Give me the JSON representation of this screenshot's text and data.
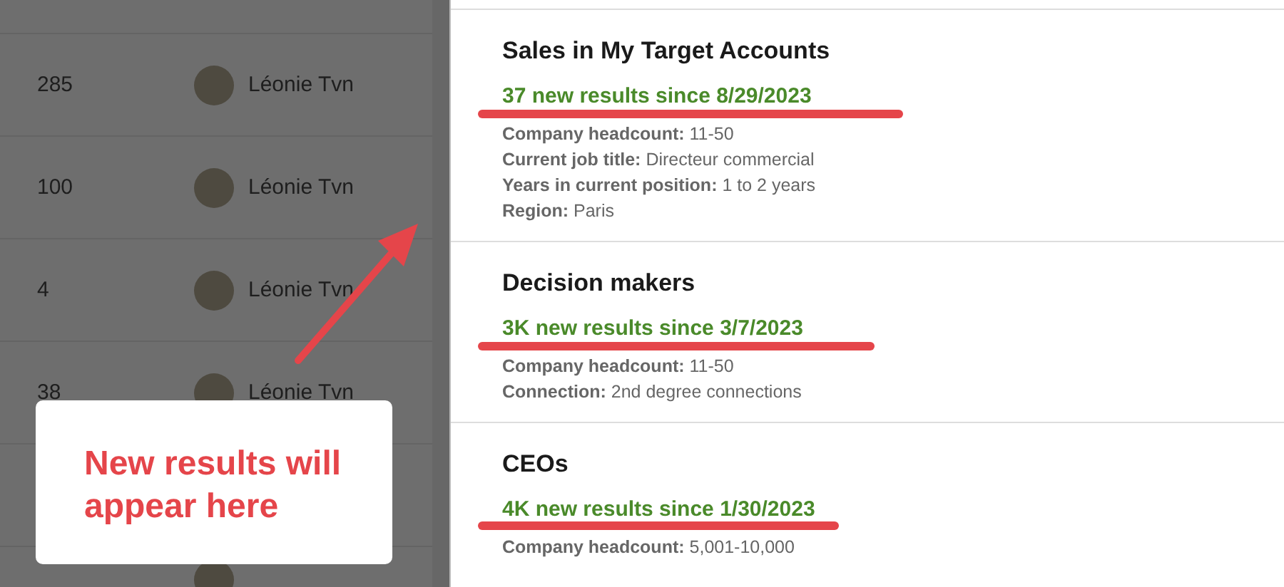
{
  "table": {
    "rows": [
      {
        "count": "285",
        "owner": "Léonie Tvn"
      },
      {
        "count": "100",
        "owner": "Léonie Tvn"
      },
      {
        "count": "4",
        "owner": "Léonie Tvn"
      },
      {
        "count": "38",
        "owner": "Léonie Tvn"
      }
    ]
  },
  "saved_searches": [
    {
      "title": "Sales in My Target Accounts",
      "new_results": "37 new results since 8/29/2023",
      "filters": [
        {
          "label": "Company headcount:",
          "value": "11-50"
        },
        {
          "label": "Current job title:",
          "value": "Directeur commercial"
        },
        {
          "label": "Years in current position:",
          "value": "1 to 2 years"
        },
        {
          "label": "Region:",
          "value": "Paris"
        }
      ]
    },
    {
      "title": "Decision makers",
      "new_results": "3K new results since 3/7/2023",
      "filters": [
        {
          "label": "Company headcount:",
          "value": "11-50"
        },
        {
          "label": "Connection:",
          "value": "2nd degree connections"
        }
      ]
    },
    {
      "title": "CEOs",
      "new_results": "4K new results since 1/30/2023",
      "filters": [
        {
          "label": "Company headcount:",
          "value": "5,001-10,000"
        }
      ]
    }
  ],
  "callout": {
    "text": "New results will appear here"
  }
}
